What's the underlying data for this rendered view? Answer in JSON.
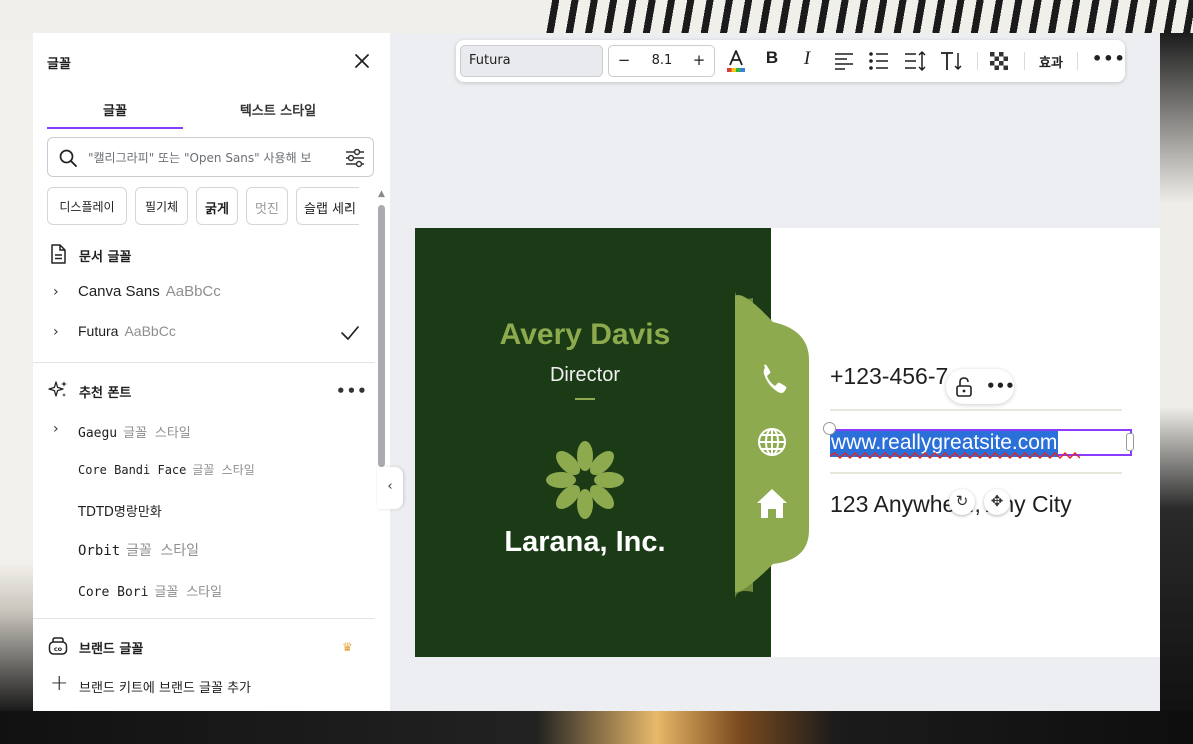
{
  "panel": {
    "title": "글꼴",
    "tabs": [
      {
        "label": "글꼴",
        "active": true
      },
      {
        "label": "텍스트 스타일",
        "active": false
      }
    ],
    "search_placeholder": "\"캘리그라피\" 또는 \"Open Sans\" 사용해 보",
    "chips": [
      "디스플레이",
      "필기체",
      "굵게",
      "멋진",
      "슬랩 세리"
    ],
    "document_fonts": {
      "heading": "문서 글꼴",
      "items": [
        {
          "name": "Canva Sans",
          "sample": "AaBbCc",
          "checked": false
        },
        {
          "name": "Futura",
          "sample": "AaBbCc",
          "checked": true
        }
      ]
    },
    "recommended": {
      "heading": "추천 폰트",
      "items": [
        {
          "name": "Gaegu",
          "sample": "글꼴 스타일",
          "expandable": true
        },
        {
          "name": "Core Bandi Face",
          "sample": "글꼴 스타일",
          "expandable": false
        },
        {
          "name": "TDTD명랑만화",
          "sample": "",
          "expandable": false
        },
        {
          "name": "Orbit",
          "sample": "글꼴 스타일",
          "expandable": false
        },
        {
          "name": "Core Bori",
          "sample": "글꼴 스타일",
          "expandable": false
        }
      ]
    },
    "brand": {
      "heading": "브랜드 글꼴",
      "add_label": "브랜드 키트에 브랜드 글꼴 추가"
    },
    "more": "•••"
  },
  "toolbar": {
    "font_name": "Futura",
    "font_size": "8.1",
    "minus": "−",
    "plus": "+",
    "bold": "B",
    "italic": "I",
    "effects": "효과",
    "more": "•••",
    "text_color_accent": "#e33b3b"
  },
  "card": {
    "name": "Avery Davis",
    "role": "Director",
    "company": "Larana, Inc.",
    "phone": "+123-456-7",
    "website": "www.reallygreatsite.com",
    "address": "123 Anywhe    t., Any City",
    "colors": {
      "dark": "#1a3b16",
      "accent": "#8eaa4f"
    }
  },
  "selection": {
    "more": "•••",
    "border_color": "#8b3dff"
  }
}
